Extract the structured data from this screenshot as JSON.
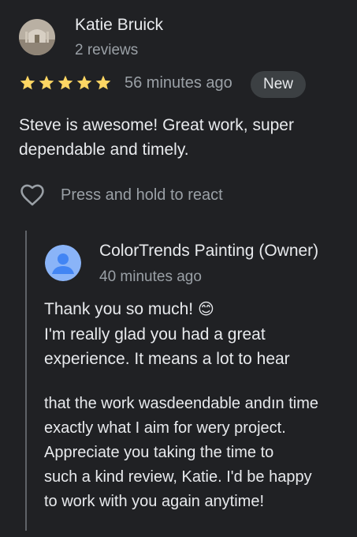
{
  "review": {
    "reviewer_name": "Katie Bruick",
    "reviewer_meta": "2 reviews",
    "rating": 5,
    "time": "56 minutes ago",
    "badge": "New",
    "text": "Steve is awesome! Great work, super dependable and timely.",
    "react_label": "Press and hold to react",
    "star_color": "#fdd663"
  },
  "reply": {
    "owner_name": "ColorTrends Painting (Owner)",
    "time": "40 minutes ago",
    "line1": "Thank you so much!",
    "emoji": "😊",
    "line2": "I'm really glad you had a great experience. It means a lot to hear",
    "lines_more": [
      "that the work wasdeendable andın time",
      "exactly what I aim for wery project.",
      "Appreciate you taking the time to",
      "such a kind review, Katie. I'd be happy",
      "to work with you again anytime!"
    ],
    "avatar_color": "#8ab4f8"
  }
}
